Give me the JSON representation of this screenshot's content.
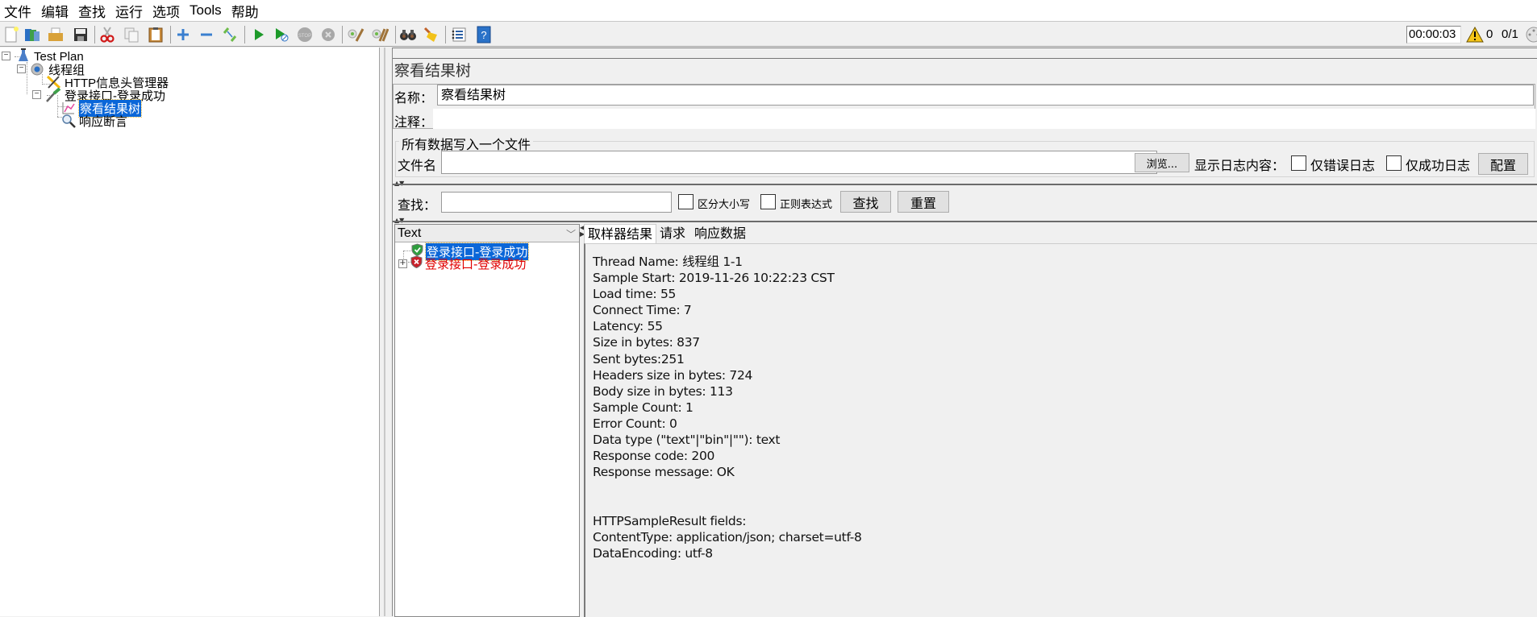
{
  "menubar": {
    "items": [
      "文件",
      "编辑",
      "查找",
      "运行",
      "选项",
      "Tools",
      "帮助"
    ]
  },
  "toolbar": {
    "buttons": [
      {
        "name": "new-icon"
      },
      {
        "name": "templates-icon"
      },
      {
        "name": "open-icon"
      },
      {
        "name": "save-icon"
      },
      {
        "name": "cut-icon"
      },
      {
        "name": "copy-icon"
      },
      {
        "name": "paste-icon"
      },
      {
        "name": "expand-icon"
      },
      {
        "name": "collapse-icon"
      },
      {
        "name": "toggle-icon"
      },
      {
        "name": "start-icon"
      },
      {
        "name": "start-no-pause-icon"
      },
      {
        "name": "stop-icon"
      },
      {
        "name": "shutdown-icon"
      },
      {
        "name": "clear-icon"
      },
      {
        "name": "clear-all-icon"
      },
      {
        "name": "search-binoculars-icon"
      },
      {
        "name": "reset-search-broom-icon"
      },
      {
        "name": "function-helper-icon"
      },
      {
        "name": "help-icon"
      }
    ],
    "elapsed_time": "00:00:03",
    "warning_count": "0",
    "active_threads": "0/1"
  },
  "tree": {
    "nodes": [
      {
        "label": "Test Plan",
        "icon": "test-plan-flask-icon",
        "level": 0,
        "expanded": true
      },
      {
        "label": "线程组",
        "icon": "thread-group-gear-icon",
        "level": 1,
        "expanded": true
      },
      {
        "label": "HTTP信息头管理器",
        "icon": "header-manager-wrench-icon",
        "level": 2
      },
      {
        "label": "登录接口-登录成功",
        "icon": "http-sampler-pipette-icon",
        "level": 2,
        "expanded": true
      },
      {
        "label": "察看结果树",
        "icon": "listener-chart-icon",
        "level": 3,
        "selected": true
      },
      {
        "label": "响应断言",
        "icon": "assertion-magnifier-icon",
        "level": 3
      }
    ]
  },
  "listener": {
    "title": "察看结果树",
    "name_label": "名称：",
    "name_value": "察看结果树",
    "comment_label": "注释：",
    "comment_value": "",
    "file_group_title": "所有数据写入一个文件",
    "filename_label": "文件名",
    "filename_value": "",
    "browse_button": "浏览...",
    "log_content_label": "显示日志内容：",
    "errors_only_label": "仅错误日志",
    "errors_only_checked": false,
    "success_only_label": "仅成功日志",
    "success_only_checked": false,
    "configure_button": "配置"
  },
  "search": {
    "label": "查找：",
    "value": "",
    "case_sensitive_label": "区分大小写",
    "case_sensitive_checked": false,
    "regex_label": "正则表达式",
    "regex_checked": false,
    "find_button": "查找",
    "reset_button": "重置"
  },
  "results": {
    "renderer": "Text",
    "items": [
      {
        "label": "登录接口-登录成功",
        "status": "success",
        "selected": true
      },
      {
        "label": "登录接口-登录成功",
        "status": "failure",
        "selected": false,
        "expandable": true
      }
    ]
  },
  "detail": {
    "tabs": [
      "取样器结果",
      "请求",
      "响应数据"
    ],
    "active_tab": 0,
    "lines": [
      "Thread Name: 线程组 1-1",
      "Sample Start: 2019-11-26 10:22:23 CST",
      "Load time: 55",
      "Connect Time: 7",
      "Latency: 55",
      "Size in bytes: 837",
      "Sent bytes:251",
      "Headers size in bytes: 724",
      "Body size in bytes: 113",
      "Sample Count: 1",
      "Error Count: 0",
      "Data type (\"text\"|\"bin\"|\"\"): text",
      "Response code: 200",
      "Response message: OK",
      "",
      "",
      "HTTPSampleResult fields:",
      "ContentType: application/json; charset=utf-8",
      "DataEncoding: utf-8"
    ]
  },
  "colors": {
    "selection": "#0a66d8",
    "failure_text": "#e00000",
    "success_shield": "#2e9e3e",
    "failure_shield": "#c8202a"
  }
}
